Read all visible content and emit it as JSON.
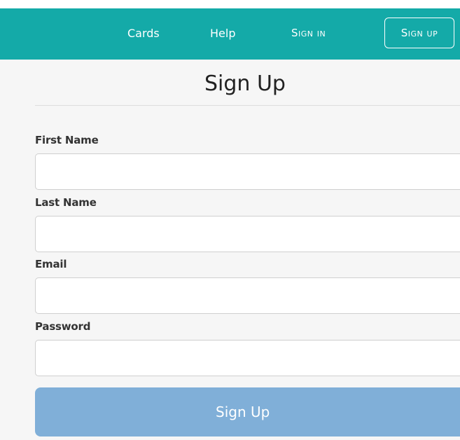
{
  "nav": {
    "cards": "Cards",
    "help": "Help",
    "sign_in": "Sign in",
    "sign_up": "Sign up"
  },
  "page": {
    "title": "Sign Up"
  },
  "form": {
    "first_name": {
      "label": "First Name",
      "value": ""
    },
    "last_name": {
      "label": "Last Name",
      "value": ""
    },
    "email": {
      "label": "Email",
      "value": ""
    },
    "password": {
      "label": "Password",
      "value": ""
    },
    "submit_label": "Sign Up"
  },
  "colors": {
    "navbar": "#14aaa8",
    "submit_button": "#80afd8",
    "background": "#f6f6f6"
  }
}
